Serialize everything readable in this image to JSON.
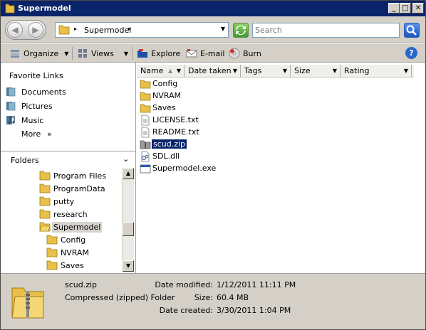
{
  "window": {
    "title": "Supermodel"
  },
  "address": {
    "path": "Supermodel",
    "search_placeholder": "Search"
  },
  "toolbar": {
    "organize": "Organize",
    "views": "Views",
    "explore": "Explore",
    "email": "E-mail",
    "burn": "Burn"
  },
  "favorites": {
    "title": "Favorite Links",
    "items": [
      "Documents",
      "Pictures",
      "Music"
    ],
    "more": "More",
    "more_arrow": "»"
  },
  "folders": {
    "title": "Folders",
    "items": [
      {
        "label": "Program Files"
      },
      {
        "label": "ProgramData"
      },
      {
        "label": "putty"
      },
      {
        "label": "research"
      },
      {
        "label": "Supermodel"
      },
      {
        "label": "Config"
      },
      {
        "label": "NVRAM"
      },
      {
        "label": "Saves"
      }
    ]
  },
  "columns": [
    "Name",
    "Date taken",
    "Tags",
    "Size",
    "Rating"
  ],
  "files": [
    {
      "name": "Config",
      "icon": "folder-icon"
    },
    {
      "name": "NVRAM",
      "icon": "folder-icon"
    },
    {
      "name": "Saves",
      "icon": "folder-icon"
    },
    {
      "name": "LICENSE.txt",
      "icon": "text-file-icon"
    },
    {
      "name": "README.txt",
      "icon": "text-file-icon"
    },
    {
      "name": "scud.zip",
      "icon": "zip-file-icon"
    },
    {
      "name": "SDL.dll",
      "icon": "dll-file-icon"
    },
    {
      "name": "Supermodel.exe",
      "icon": "exe-file-icon"
    }
  ],
  "details": {
    "name": "scud.zip",
    "type": "Compressed (zipped) Folder",
    "date_modified_label": "Date modified:",
    "date_modified": "1/12/2011 11:11 PM",
    "size_label": "Size:",
    "size": "60.4 MB",
    "date_created_label": "Date created:",
    "date_created": "3/30/2011 1:04 PM"
  },
  "colors": {
    "titlebar": "#0a246a",
    "chrome": "#d4d0c8",
    "selection": "#0a246a",
    "folder_yellow": "#e8c04a"
  }
}
